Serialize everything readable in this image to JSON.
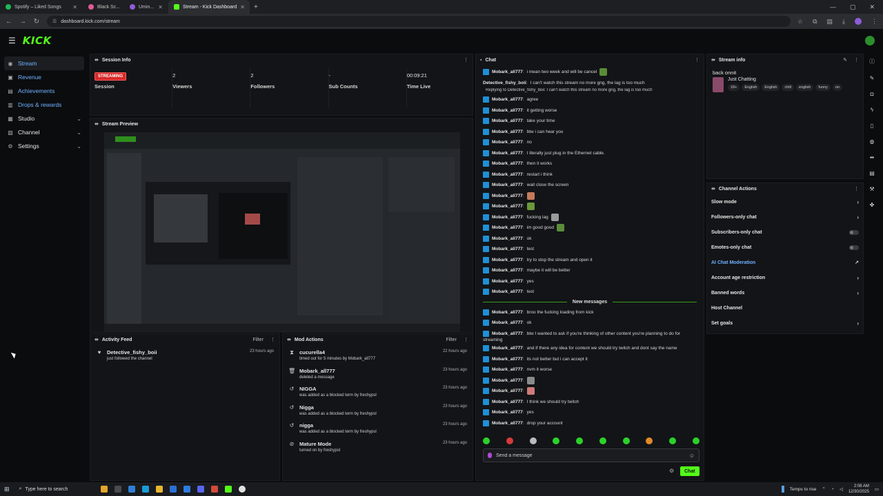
{
  "browser": {
    "tabs": [
      {
        "label": "Spotify – Liked Songs",
        "color": "#1db954"
      },
      {
        "label": "Black Sc...",
        "color": "#e05a9b"
      },
      {
        "label": "Umin...",
        "color": "#8e5cd8"
      },
      {
        "label": "Stream - Kick Dashboard",
        "color": "#53fc18"
      }
    ],
    "new_tab": "+",
    "url": "dashboard.kick.com/stream"
  },
  "header": {
    "logo": "KICK"
  },
  "sidebar": {
    "items": [
      {
        "label": "Stream",
        "icon": "stream-icon"
      },
      {
        "label": "Revenue",
        "icon": "revenue-icon"
      },
      {
        "label": "Achievements",
        "icon": "achievements-icon"
      },
      {
        "label": "Drops & rewards",
        "icon": "drops-icon"
      },
      {
        "label": "Studio",
        "icon": "studio-icon"
      },
      {
        "label": "Channel",
        "icon": "channel-icon"
      },
      {
        "label": "Settings",
        "icon": "settings-icon"
      }
    ]
  },
  "session": {
    "title": "Session Info",
    "badge": "STREAMING",
    "stats": [
      {
        "value": "",
        "label": "Session"
      },
      {
        "value": "2",
        "label": "Viewers"
      },
      {
        "value": "2",
        "label": "Followers"
      },
      {
        "value": "-",
        "label": "Sub Counts"
      },
      {
        "value": "00:09:21",
        "label": "Time Live"
      }
    ]
  },
  "preview": {
    "title": "Stream Preview"
  },
  "activity": {
    "title": "Activity Feed",
    "filter": "Filter",
    "items": [
      {
        "name": "Detective_fishy_boii",
        "sub": "just followed the channel",
        "time": "23 hours ago"
      }
    ]
  },
  "mod": {
    "title": "Mod Actions",
    "filter": "Filter",
    "items": [
      {
        "name": "cucurella4",
        "sub": "timed out for 5 minutes by Mobark_all777",
        "time": "22 hours ago",
        "icon": "hourglass-icon"
      },
      {
        "name": "Mobark_all777",
        "sub": "deleted a message",
        "time": "23 hours ago",
        "icon": "trash-icon"
      },
      {
        "name": "NIGGA",
        "sub": "was added as a blocked term by freshypsl",
        "time": "23 hours ago",
        "icon": "undo-icon"
      },
      {
        "name": "Nigga",
        "sub": "was added as a blocked term by freshypsl",
        "time": "23 hours ago",
        "icon": "undo-icon"
      },
      {
        "name": "nigga",
        "sub": "was added as a blocked term by freshypsl",
        "time": "23 hours ago",
        "icon": "undo-icon"
      },
      {
        "name": "Mature Mode",
        "sub": "turned on by freshypsl",
        "time": "23 hours ago",
        "icon": "mature-icon"
      }
    ]
  },
  "chat": {
    "title": "Chat",
    "top": [
      {
        "user": "Mobark_all777",
        "text": "i mean two week and will be cancel",
        "emote": "#5b8c3a"
      },
      {
        "user": "Detective_fishy_boii",
        "text": "I can't watch this stream no more gng, the lag is too much",
        "nobadge": true
      }
    ],
    "reply": "Replying to Detective_fishy_boii: I can't watch this stream no more gng, the lag is too much",
    "lines": [
      {
        "user": "Mobark_all777",
        "text": "agree"
      },
      {
        "user": "Mobark_all777",
        "text": "it getting worse"
      },
      {
        "user": "Mobark_all777",
        "text": "take your time"
      },
      {
        "user": "Mobark_all777",
        "text": "btw i can hear you"
      },
      {
        "user": "Mobark_all777",
        "text": "no"
      },
      {
        "user": "Mobark_all777",
        "text": "I literally just plug in the Ethernet cable."
      },
      {
        "user": "Mobark_all777",
        "text": "then it works"
      },
      {
        "user": "Mobark_all777",
        "text": "restart i think"
      },
      {
        "user": "Mobark_all777",
        "text": "wait close the screen"
      },
      {
        "user": "Mobark_all777",
        "text": "",
        "emote": "#c47a5a"
      },
      {
        "user": "Mobark_all777",
        "text": "",
        "emote": "#6a9a3a"
      },
      {
        "user": "Mobark_all777",
        "text": "fucking lag",
        "emote": "#9a9a9a"
      },
      {
        "user": "Mobark_all777",
        "text": "im good good",
        "emote": "#5b8c3a"
      },
      {
        "user": "Mobark_all777",
        "text": "ok"
      },
      {
        "user": "Mobark_all777",
        "text": "test"
      },
      {
        "user": "Mobark_all777",
        "text": "try to stop the stream and open it"
      },
      {
        "user": "Mobark_all777",
        "text": "maybe it will be better"
      },
      {
        "user": "Mobark_all777",
        "text": "yes"
      },
      {
        "user": "Mobark_all777",
        "text": "test"
      }
    ],
    "new_messages": "New messages",
    "new_lines": [
      {
        "user": "Mobark_all777",
        "text": "broo the fucking loading from kick"
      },
      {
        "user": "Mobark_all777",
        "text": "ok"
      },
      {
        "user": "Mobark_all777",
        "text": "btw I wanted to ask if you're thinking of other content you're planning to do for",
        "cont": "streaming"
      },
      {
        "user": "Mobark_all777",
        "text": "and if there any idea for content we should try twitch and dont say the name"
      },
      {
        "user": "Mobark_all777",
        "text": "its not better but i can accept it"
      },
      {
        "user": "Mobark_all777",
        "text": "nvm it worse"
      },
      {
        "user": "Mobark_all777",
        "text": "",
        "emote": "#8a8a8a"
      },
      {
        "user": "Mobark_all777",
        "text": "",
        "emote": "#d07a7a"
      },
      {
        "user": "Mobark_all777",
        "text": "I think we should try twitch"
      },
      {
        "user": "Mobark_all777",
        "text": "yes"
      },
      {
        "user": "Mobark_all777",
        "text": "drop your account"
      }
    ],
    "input_placeholder": "Send a message",
    "send_label": "Chat"
  },
  "stream_info": {
    "title": "Stream info",
    "stream_title": "back onnit",
    "category": "Just Chatting",
    "tags": [
      "18+",
      "English",
      "English",
      "chill",
      "english",
      "funny",
      "on"
    ]
  },
  "actions": {
    "title": "Channel Actions",
    "items": [
      {
        "label": "Slow mode",
        "control": "arrow"
      },
      {
        "label": "Followers-only chat",
        "control": "arrow"
      },
      {
        "label": "Subscribers-only chat",
        "control": "toggle"
      },
      {
        "label": "Emotes-only chat",
        "control": "toggle"
      },
      {
        "label": "AI Chat Moderation",
        "control": "external",
        "link": true
      },
      {
        "label": "Account age restriction",
        "control": "arrow"
      },
      {
        "label": "Banned words",
        "control": "arrow"
      },
      {
        "label": "Host Channel",
        "control": "none"
      },
      {
        "label": "Set goals",
        "control": "arrow"
      }
    ]
  },
  "taskbar": {
    "search_placeholder": "Type here to search",
    "weather": "Temps to rise",
    "time": "2:08 AM",
    "date": "12/30/2025"
  },
  "colors": {
    "accent": "#53fc18",
    "link": "#6fb3ff",
    "live": "#d62a2a"
  }
}
